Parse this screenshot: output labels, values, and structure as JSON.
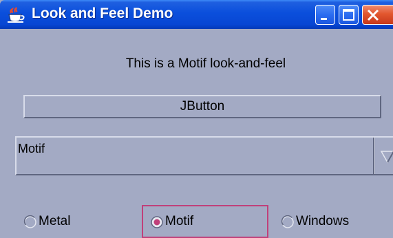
{
  "window": {
    "title": "Look and Feel Demo",
    "icon": "java-coffee-cup-icon",
    "controls": [
      "minimize-icon",
      "maximize-icon",
      "close-icon"
    ]
  },
  "content": {
    "label": "This is a Motif look-and-feel",
    "button_label": "JButton",
    "combo": {
      "selected": "Motif",
      "arrow_icon": "triangle-down-icon"
    },
    "radios": [
      {
        "label": "Metal",
        "selected": false
      },
      {
        "label": "Motif",
        "selected": true
      },
      {
        "label": "Windows",
        "selected": false
      }
    ]
  },
  "colors": {
    "background": "#a3aac4",
    "titlebar": "#0a4fdc",
    "radio_selected": "#c0407a",
    "close_button": "#e2572f"
  }
}
